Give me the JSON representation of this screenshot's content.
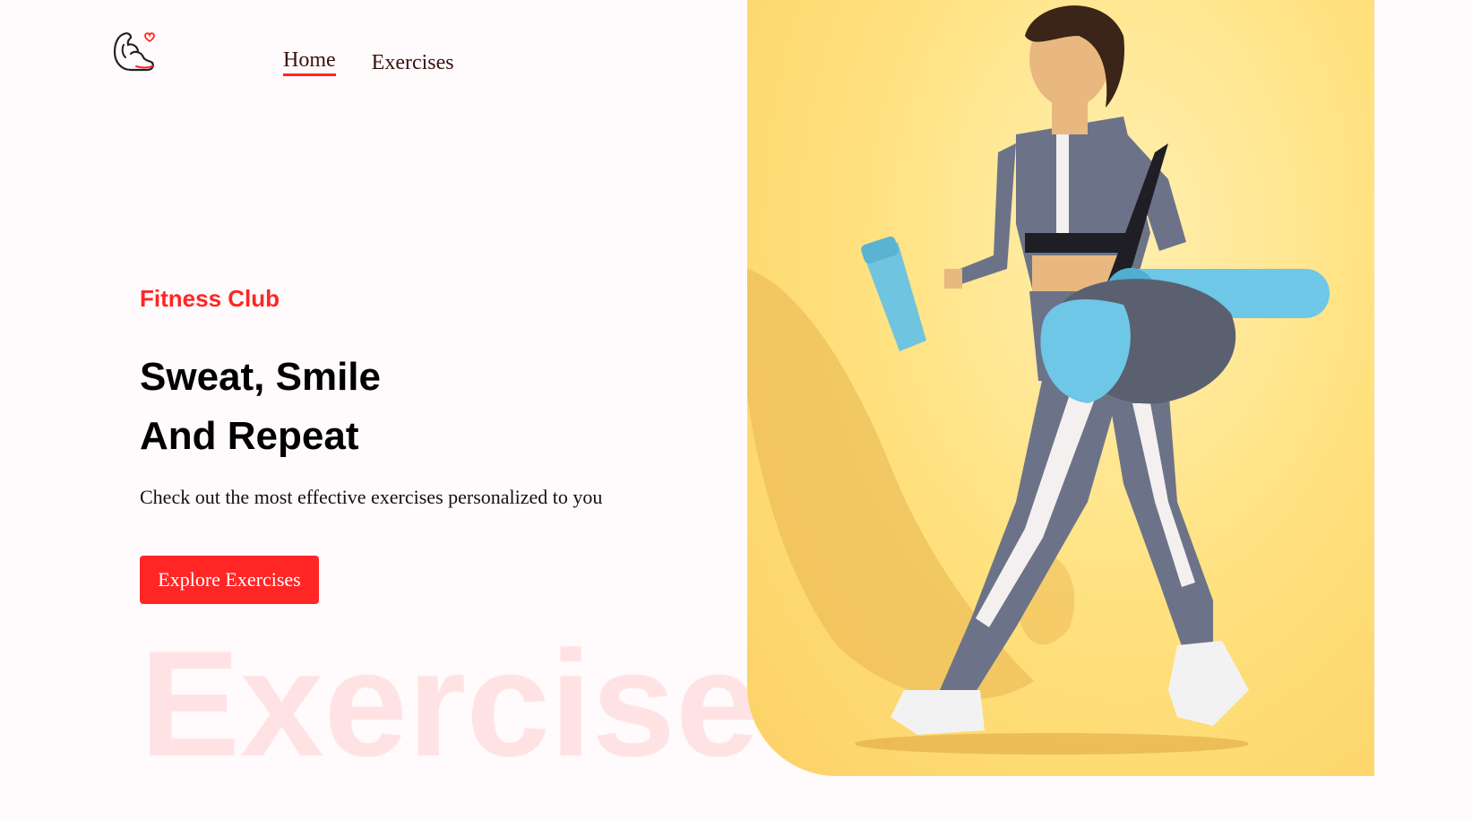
{
  "nav": {
    "home_label": "Home",
    "exercises_label": "Exercises"
  },
  "hero": {
    "subtitle": "Fitness Club",
    "title_line1": "Sweat, Smile",
    "title_line2": "And Repeat",
    "description": "Check out the most effective exercises personalized to you",
    "button_label": "Explore Exercises",
    "watermark": "Exercise"
  },
  "icons": {
    "logo": "flexed-arm-heart-icon"
  },
  "colors": {
    "accent": "#FF2625",
    "background": "#FFFAFB",
    "banner_bg": "#FFE17E"
  }
}
